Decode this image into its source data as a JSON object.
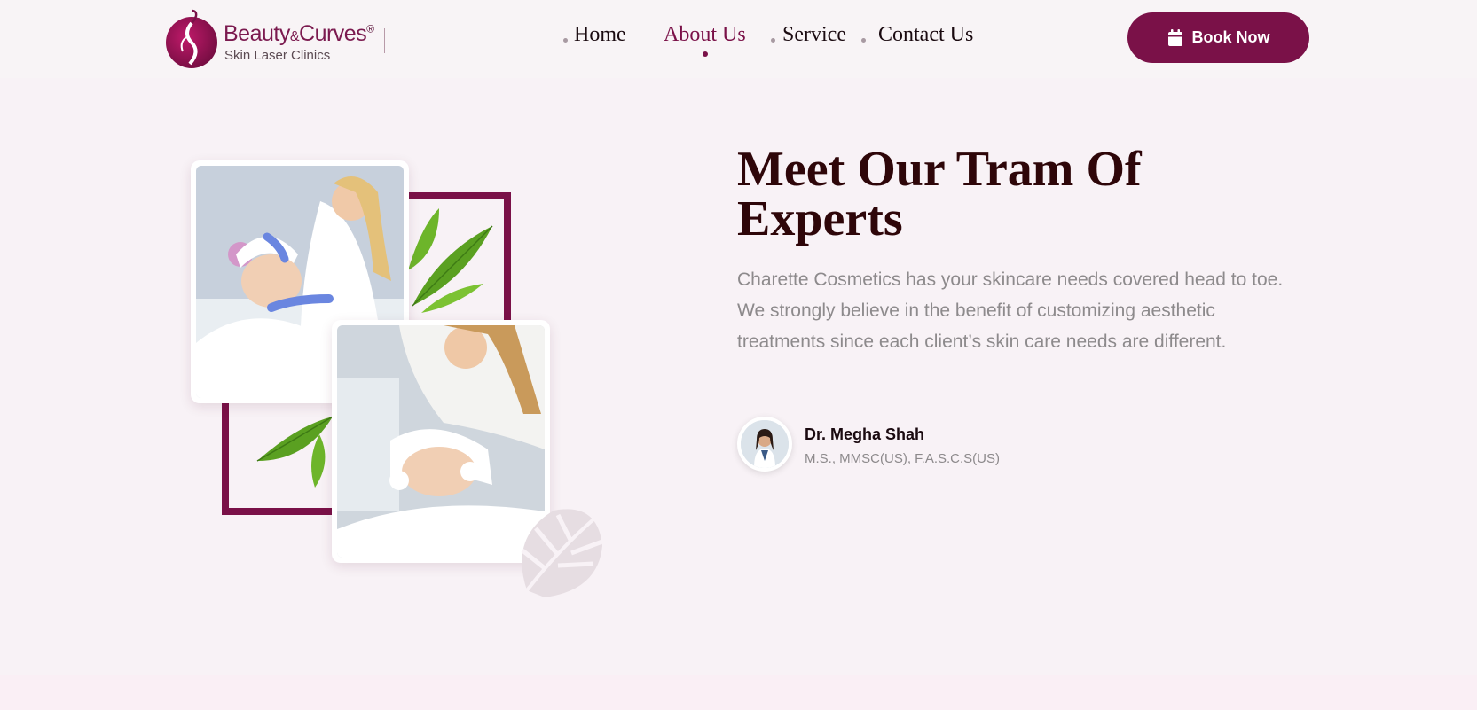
{
  "brand": {
    "name_part1": "Beauty",
    "name_amp": "&",
    "name_part2": "Curves",
    "registered": "®",
    "tagline": "Skin Laser Clinics"
  },
  "nav": {
    "items": [
      {
        "label": "Home",
        "active": false
      },
      {
        "label": "About Us",
        "active": true
      },
      {
        "label": "Service",
        "active": false
      },
      {
        "label": "Contact Us",
        "active": false
      }
    ]
  },
  "cta": {
    "label": "Book Now",
    "icon": "calendar-icon"
  },
  "about": {
    "heading": "Meet Our Tram Of Experts",
    "description": "Charette Cosmetics has your skincare needs covered head to toe. We strongly believe in the benefit of customizing aesthetic treatments since each client’s skin care needs are different.",
    "doctor": {
      "name": "Dr. Megha Shah",
      "credentials": "M.S., MMSC(US), F.A.S.C.S(US)"
    }
  },
  "colors": {
    "brand": "#7a1148",
    "heading": "#2e0609",
    "muted_text": "#8d8a8c",
    "background": "#f8f2f6"
  }
}
